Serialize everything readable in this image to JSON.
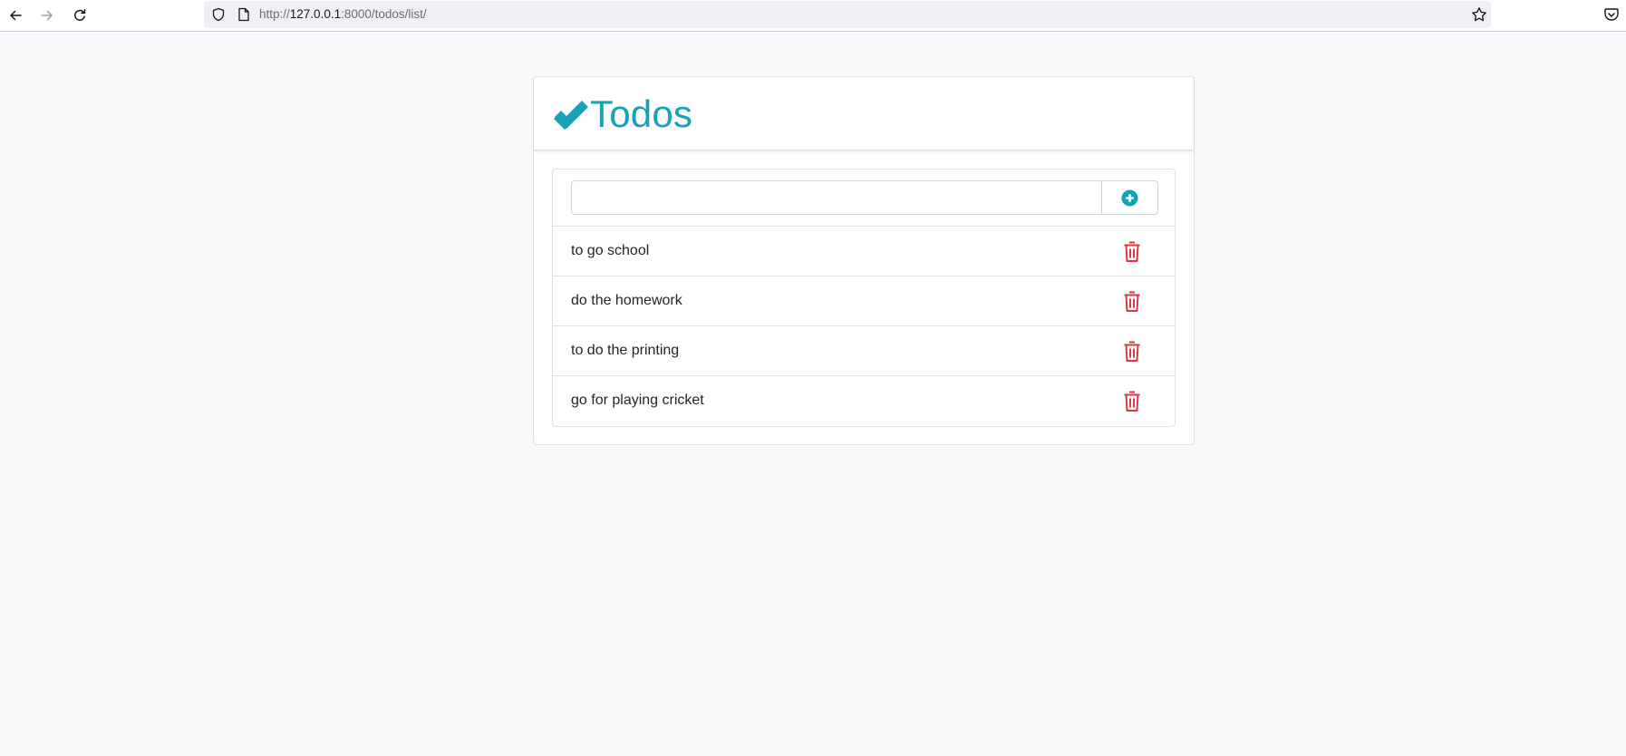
{
  "browser": {
    "url_prefix": "http://",
    "url_host": "127.0.0.1",
    "url_rest": ":8000/todos/list/",
    "icons": [
      "back-arrow-icon",
      "forward-arrow-icon",
      "reload-icon",
      "shield-icon",
      "page-icon",
      "star-icon",
      "pocket-icon"
    ]
  },
  "app": {
    "title": "Todos",
    "brand_icon": "double-check-icon",
    "accent_color": "#17a2b8",
    "danger_color": "#dc3545",
    "new_todo": {
      "value": "",
      "placeholder": ""
    },
    "add_icon": "plus-circle-icon",
    "delete_icon": "trash-icon",
    "todos": [
      {
        "text": "to go school"
      },
      {
        "text": "do the homework"
      },
      {
        "text": "to do the printing"
      },
      {
        "text": "go for playing cricket"
      }
    ]
  }
}
